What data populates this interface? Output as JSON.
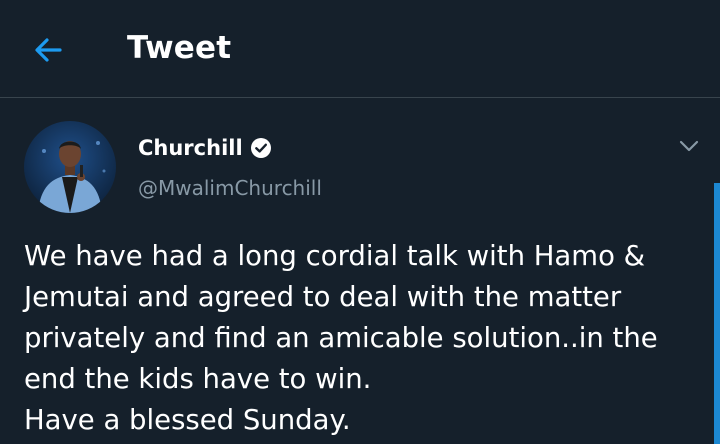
{
  "header": {
    "title": "Tweet",
    "back_icon": "arrow-left-icon"
  },
  "tweet": {
    "author": {
      "display_name": "Churchill",
      "handle": "@MwalimChurchill",
      "verified": true,
      "verified_icon": "verified-badge-icon"
    },
    "menu_icon": "chevron-down-icon",
    "text": "We have had a long cordial talk with Hamo &\nJemutai and agreed to deal with the matter\nprivately and find an amicable solution..in the\nend the kids have to win.\nHave a blessed Sunday."
  },
  "colors": {
    "background": "#15202b",
    "accent": "#1d9bf0",
    "secondary_text": "#8899a6",
    "divider": "#38444d"
  }
}
